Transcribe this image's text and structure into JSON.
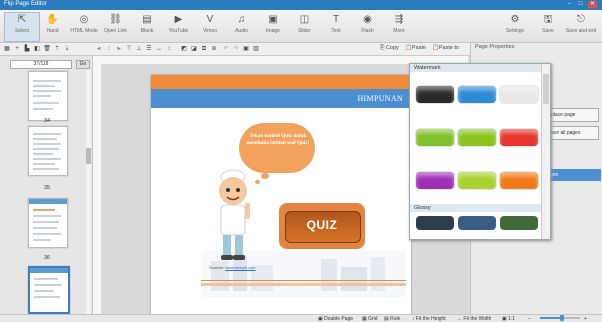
{
  "window": {
    "title": "Flip Page Editor",
    "controls": [
      "–",
      "□",
      "✕"
    ]
  },
  "ribbon": {
    "left_tools": [
      {
        "label": "Select",
        "icon": "select-icon",
        "glyph": "⇱"
      },
      {
        "label": "Hand",
        "icon": "hand-icon",
        "glyph": "✋"
      },
      {
        "label": "HTML Mode",
        "icon": "html-mode-icon",
        "glyph": "◎"
      },
      {
        "label": "Open Link",
        "icon": "link-icon",
        "glyph": "⛓"
      },
      {
        "label": "Blank",
        "icon": "blank-icon",
        "glyph": "▤"
      },
      {
        "label": "YouTube",
        "icon": "youtube-icon",
        "glyph": "▶"
      },
      {
        "label": "Vimeo",
        "icon": "vimeo-icon",
        "glyph": "V"
      },
      {
        "label": "Audio",
        "icon": "audio-icon",
        "glyph": "♫"
      },
      {
        "label": "Image",
        "icon": "image-icon",
        "glyph": "▣"
      },
      {
        "label": "Slider",
        "icon": "slider-icon",
        "glyph": "◫"
      },
      {
        "label": "Text",
        "icon": "text-icon",
        "glyph": "T"
      },
      {
        "label": "Flash",
        "icon": "flash-icon",
        "glyph": "◉"
      },
      {
        "label": "More",
        "icon": "more-icon",
        "glyph": "⇶"
      }
    ],
    "right_tools": [
      {
        "label": "Settings",
        "icon": "gear-icon",
        "glyph": "⚙"
      },
      {
        "label": "Save",
        "icon": "save-icon",
        "glyph": "🖫"
      },
      {
        "label": "Save and exit",
        "icon": "save-exit-icon",
        "glyph": "⎋"
      }
    ]
  },
  "toolbar": {
    "copy": "Copy",
    "paste": "Paste",
    "paste_to": "Paste to"
  },
  "right_panel": {
    "title": "Page Properties",
    "buttons": [
      "place page",
      "ace all pages"
    ],
    "highlight": "ges"
  },
  "thumbnails": {
    "page_input": "37/118",
    "go_label": "Go",
    "numbers": [
      "34",
      "35",
      "36"
    ]
  },
  "slide": {
    "header": "HIMPUNAN",
    "cloud_text": "Tekan tombol Quiz untuk membuka latihan soal Quiz!",
    "quiz_label": "QUIZ",
    "credit_prefix": "Sumber:",
    "credit_link": "www.freepik.com"
  },
  "watermark_popup": {
    "section1": "Watermark",
    "section2": "Glossy",
    "rows": [
      [
        "#2a2a2a",
        "#2f8ad4",
        "#e9e9e9"
      ],
      [
        "#7ec128",
        "#8bc41e",
        "#e8342c"
      ],
      [
        "#9c2fb4",
        "#a7d32b",
        "#ef7a1c"
      ]
    ]
  },
  "status": {
    "double_page": "Double Page",
    "grid": "Grid",
    "rule": "Rule",
    "fit_height": "Fit the Height",
    "fit_width": "Fit the Width",
    "ratio": "1:1",
    "zoom_fraction": 0.55
  }
}
